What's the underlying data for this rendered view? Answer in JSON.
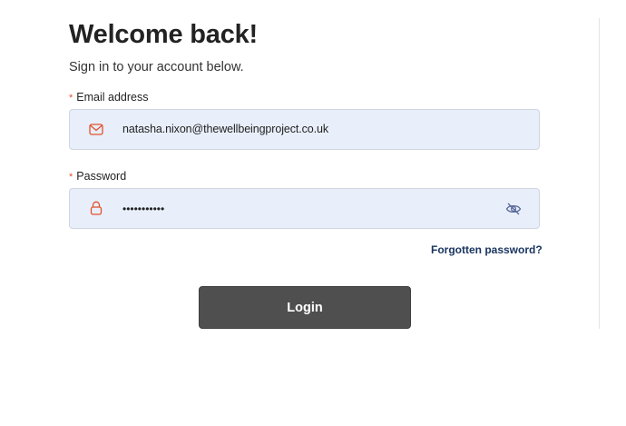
{
  "header": {
    "title": "Welcome back!",
    "subtitle": "Sign in to your account below."
  },
  "form": {
    "email": {
      "required_marker": "*",
      "label": "Email address",
      "value": "natasha.nixon@thewellbeingproject.co.uk",
      "icon": "envelope-icon"
    },
    "password": {
      "required_marker": "*",
      "label": "Password",
      "value_masked": "•••••••••••",
      "icon": "lock-icon",
      "toggle_icon": "eye-off-icon"
    },
    "forgot_link": "Forgotten password?",
    "login_label": "Login"
  },
  "colors": {
    "accent_icon": "#e2502a",
    "input_bg": "#e8effb",
    "button_bg": "#4f4f4f",
    "link": "#1a3560",
    "toggle_icon": "#5a6a9a"
  }
}
